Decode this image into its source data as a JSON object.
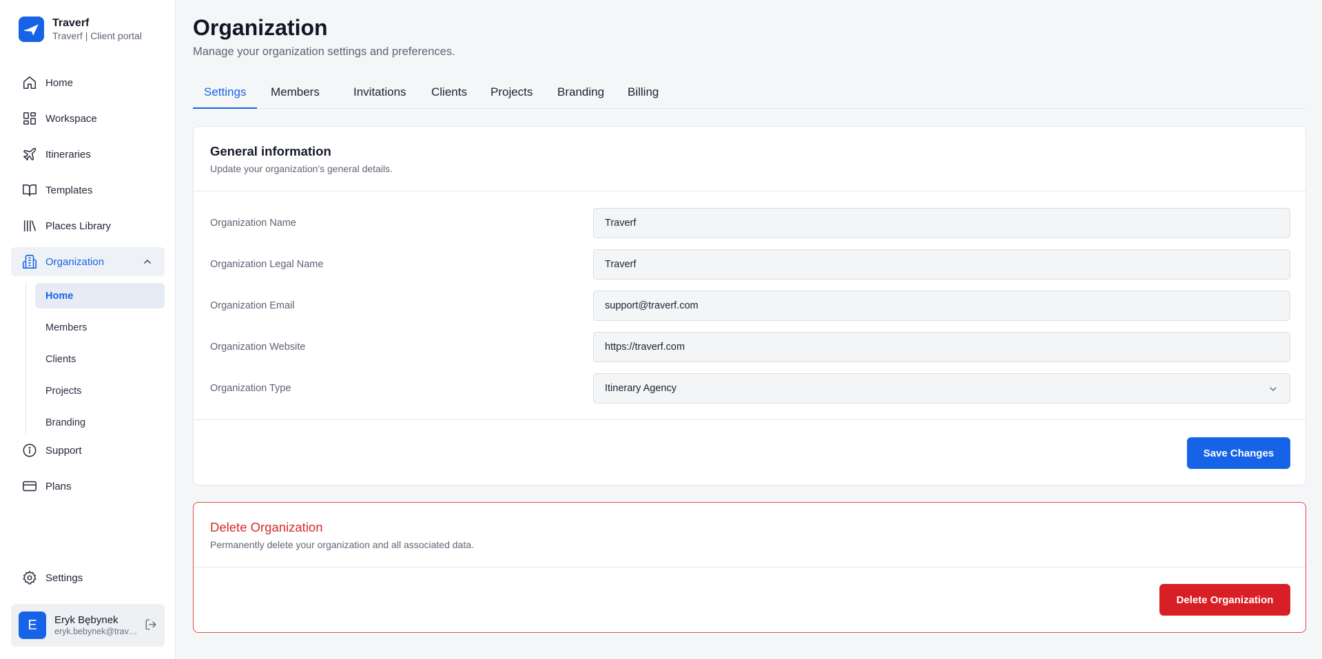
{
  "brand": {
    "name": "Traverf",
    "subtitle": "Traverf | Client portal"
  },
  "nav": [
    {
      "label": "Home",
      "icon": "home-icon"
    },
    {
      "label": "Workspace",
      "icon": "grid-icon"
    },
    {
      "label": "Itineraries",
      "icon": "plane-icon"
    },
    {
      "label": "Templates",
      "icon": "book-icon"
    },
    {
      "label": "Places Library",
      "icon": "library-icon"
    },
    {
      "label": "Organization",
      "icon": "building-icon",
      "active": true
    }
  ],
  "org_subnav": [
    {
      "label": "Home",
      "active": true
    },
    {
      "label": "Members"
    },
    {
      "label": "Clients"
    },
    {
      "label": "Projects"
    },
    {
      "label": "Branding"
    }
  ],
  "nav_bottom": [
    {
      "label": "Support",
      "icon": "info-icon"
    },
    {
      "label": "Plans",
      "icon": "credit-card-icon"
    }
  ],
  "settings_label": "Settings",
  "user": {
    "initial": "E",
    "name": "Eryk Bębynek",
    "email": "eryk.bebynek@traverf.com"
  },
  "page": {
    "title": "Organization",
    "subtitle": "Manage your organization settings and preferences."
  },
  "tabs": [
    "Settings",
    "Members",
    "Invitations",
    "Clients",
    "Projects",
    "Branding",
    "Billing"
  ],
  "general": {
    "title": "General information",
    "description": "Update your organization's general details.",
    "fields": [
      {
        "label": "Organization Name",
        "value": "Traverf"
      },
      {
        "label": "Organization Legal Name",
        "value": "Traverf"
      },
      {
        "label": "Organization Email",
        "value": "support@traverf.com"
      },
      {
        "label": "Organization Website",
        "value": "https://traverf.com"
      },
      {
        "label": "Organization Type",
        "value": "Itinerary Agency"
      }
    ],
    "save_label": "Save Changes"
  },
  "danger": {
    "title": "Delete Organization",
    "description": "Permanently delete your organization and all associated data.",
    "button_label": "Delete Organization"
  },
  "colors": {
    "accent": "#1763e8",
    "danger": "#d91f26"
  }
}
